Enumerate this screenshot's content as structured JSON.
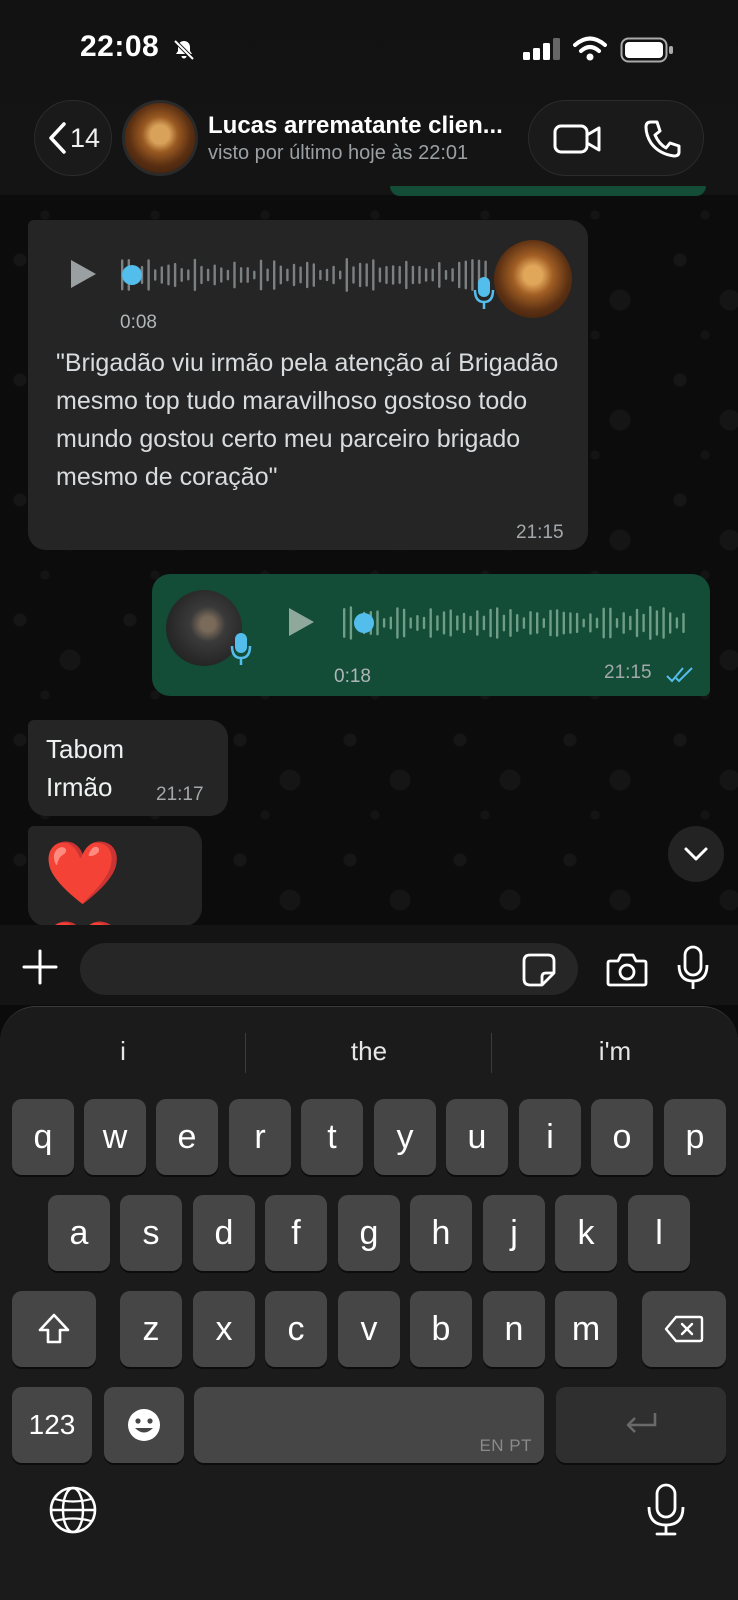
{
  "status_bar": {
    "time": "22:08"
  },
  "header": {
    "back_count": "14",
    "contact_name": "Lucas arrematante clien...",
    "contact_status": "visto por último hoje às 22:01"
  },
  "messages": [
    {
      "type": "voice",
      "direction": "incoming",
      "duration": "0:08",
      "transcript": "\"Brigadão viu irmão pela atenção aí Brigadão mesmo top tudo maravilhoso gostoso todo mundo gostou certo meu parceiro brigado mesmo de coração\"",
      "time": "21:15"
    },
    {
      "type": "voice",
      "direction": "outgoing",
      "duration": "0:18",
      "time": "21:15",
      "status": "read"
    },
    {
      "type": "text",
      "direction": "incoming",
      "text": "Tabom Irmão",
      "time": "21:17"
    },
    {
      "type": "emoji",
      "direction": "incoming",
      "text": "❤️ ❤️"
    }
  ],
  "composer": {
    "placeholder": "",
    "value": ""
  },
  "keyboard": {
    "suggestions": [
      "i",
      "the",
      "i'm"
    ],
    "row1": [
      "q",
      "w",
      "e",
      "r",
      "t",
      "y",
      "u",
      "i",
      "o",
      "p"
    ],
    "row2": [
      "a",
      "s",
      "d",
      "f",
      "g",
      "h",
      "j",
      "k",
      "l"
    ],
    "row3": [
      "z",
      "x",
      "c",
      "v",
      "b",
      "n",
      "m"
    ],
    "numbers_key": "123",
    "language_label": "EN PT"
  },
  "colors": {
    "outgoing_bubble": "#134d37",
    "incoming_bubble": "#252525",
    "accent_blue": "#53bdeb",
    "keyboard_key": "#464646"
  }
}
